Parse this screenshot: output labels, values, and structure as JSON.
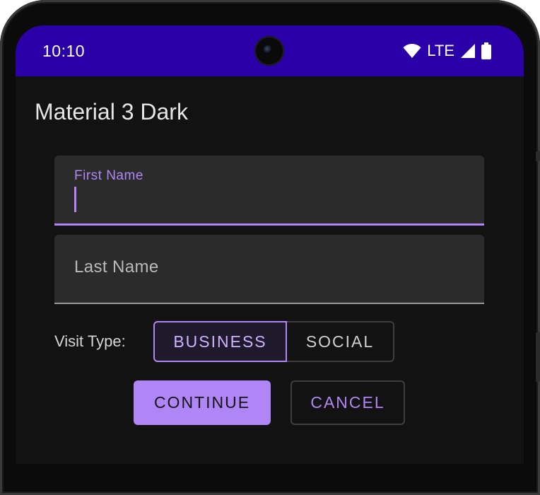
{
  "status_bar": {
    "time": "10:10",
    "network": "LTE",
    "icons": [
      "wifi-icon",
      "signal-icon",
      "battery-icon"
    ],
    "color": "#2a00a8"
  },
  "app": {
    "title": "Material 3 Dark"
  },
  "form": {
    "first_name": {
      "label": "First Name",
      "value": "",
      "focused": true
    },
    "last_name": {
      "placeholder": "Last Name",
      "value": ""
    },
    "visit_type": {
      "label": "Visit Type:",
      "options": [
        "BUSINESS",
        "SOCIAL"
      ],
      "selected": "BUSINESS"
    }
  },
  "actions": {
    "continue_label": "CONTINUE",
    "cancel_label": "CANCEL"
  },
  "colors": {
    "accent": "#b085f5",
    "background": "#121212",
    "surface": "#2b2b2b"
  }
}
